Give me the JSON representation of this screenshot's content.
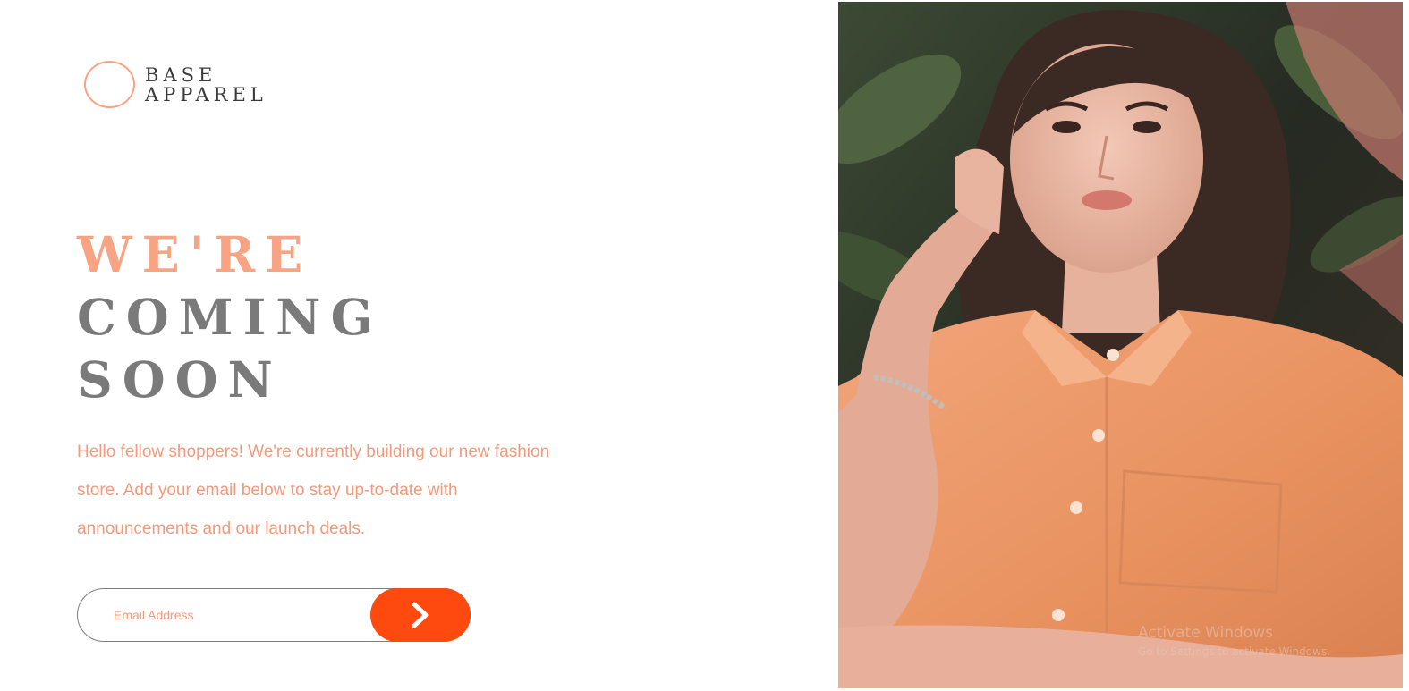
{
  "brand": {
    "line1": "BASE",
    "line2": "APPAREL"
  },
  "headline": {
    "accent": "WE'RE",
    "line2": "COMING",
    "line3": "SOON"
  },
  "intro": "Hello fellow shoppers! We're currently building our new fashion store. Add your email below to stay up-to-date with announcements and our launch deals.",
  "signup": {
    "placeholder": "Email Address",
    "submit_icon": "chevron-right-icon"
  },
  "hero_image": {
    "description_icon": "model-photo"
  },
  "watermark": {
    "title": "Activate Windows",
    "subtitle": "Go to Settings to activate Windows."
  },
  "colors": {
    "accent": "#f8a383",
    "text_accent": "#f49a7c",
    "button": "#fe4a0f",
    "heading_gray": "#7a7a7a"
  }
}
